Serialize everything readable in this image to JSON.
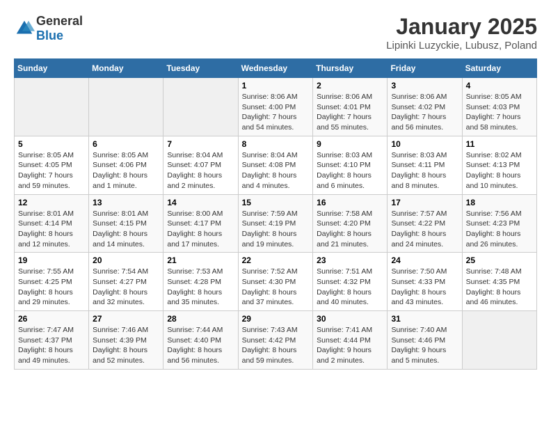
{
  "header": {
    "logo_general": "General",
    "logo_blue": "Blue",
    "title": "January 2025",
    "subtitle": "Lipinki Luzyckie, Lubusz, Poland"
  },
  "days_of_week": [
    "Sunday",
    "Monday",
    "Tuesday",
    "Wednesday",
    "Thursday",
    "Friday",
    "Saturday"
  ],
  "weeks": [
    [
      {
        "day": "",
        "info": ""
      },
      {
        "day": "",
        "info": ""
      },
      {
        "day": "",
        "info": ""
      },
      {
        "day": "1",
        "info": "Sunrise: 8:06 AM\nSunset: 4:00 PM\nDaylight: 7 hours and 54 minutes."
      },
      {
        "day": "2",
        "info": "Sunrise: 8:06 AM\nSunset: 4:01 PM\nDaylight: 7 hours and 55 minutes."
      },
      {
        "day": "3",
        "info": "Sunrise: 8:06 AM\nSunset: 4:02 PM\nDaylight: 7 hours and 56 minutes."
      },
      {
        "day": "4",
        "info": "Sunrise: 8:05 AM\nSunset: 4:03 PM\nDaylight: 7 hours and 58 minutes."
      }
    ],
    [
      {
        "day": "5",
        "info": "Sunrise: 8:05 AM\nSunset: 4:05 PM\nDaylight: 7 hours and 59 minutes."
      },
      {
        "day": "6",
        "info": "Sunrise: 8:05 AM\nSunset: 4:06 PM\nDaylight: 8 hours and 1 minute."
      },
      {
        "day": "7",
        "info": "Sunrise: 8:04 AM\nSunset: 4:07 PM\nDaylight: 8 hours and 2 minutes."
      },
      {
        "day": "8",
        "info": "Sunrise: 8:04 AM\nSunset: 4:08 PM\nDaylight: 8 hours and 4 minutes."
      },
      {
        "day": "9",
        "info": "Sunrise: 8:03 AM\nSunset: 4:10 PM\nDaylight: 8 hours and 6 minutes."
      },
      {
        "day": "10",
        "info": "Sunrise: 8:03 AM\nSunset: 4:11 PM\nDaylight: 8 hours and 8 minutes."
      },
      {
        "day": "11",
        "info": "Sunrise: 8:02 AM\nSunset: 4:13 PM\nDaylight: 8 hours and 10 minutes."
      }
    ],
    [
      {
        "day": "12",
        "info": "Sunrise: 8:01 AM\nSunset: 4:14 PM\nDaylight: 8 hours and 12 minutes."
      },
      {
        "day": "13",
        "info": "Sunrise: 8:01 AM\nSunset: 4:15 PM\nDaylight: 8 hours and 14 minutes."
      },
      {
        "day": "14",
        "info": "Sunrise: 8:00 AM\nSunset: 4:17 PM\nDaylight: 8 hours and 17 minutes."
      },
      {
        "day": "15",
        "info": "Sunrise: 7:59 AM\nSunset: 4:19 PM\nDaylight: 8 hours and 19 minutes."
      },
      {
        "day": "16",
        "info": "Sunrise: 7:58 AM\nSunset: 4:20 PM\nDaylight: 8 hours and 21 minutes."
      },
      {
        "day": "17",
        "info": "Sunrise: 7:57 AM\nSunset: 4:22 PM\nDaylight: 8 hours and 24 minutes."
      },
      {
        "day": "18",
        "info": "Sunrise: 7:56 AM\nSunset: 4:23 PM\nDaylight: 8 hours and 26 minutes."
      }
    ],
    [
      {
        "day": "19",
        "info": "Sunrise: 7:55 AM\nSunset: 4:25 PM\nDaylight: 8 hours and 29 minutes."
      },
      {
        "day": "20",
        "info": "Sunrise: 7:54 AM\nSunset: 4:27 PM\nDaylight: 8 hours and 32 minutes."
      },
      {
        "day": "21",
        "info": "Sunrise: 7:53 AM\nSunset: 4:28 PM\nDaylight: 8 hours and 35 minutes."
      },
      {
        "day": "22",
        "info": "Sunrise: 7:52 AM\nSunset: 4:30 PM\nDaylight: 8 hours and 37 minutes."
      },
      {
        "day": "23",
        "info": "Sunrise: 7:51 AM\nSunset: 4:32 PM\nDaylight: 8 hours and 40 minutes."
      },
      {
        "day": "24",
        "info": "Sunrise: 7:50 AM\nSunset: 4:33 PM\nDaylight: 8 hours and 43 minutes."
      },
      {
        "day": "25",
        "info": "Sunrise: 7:48 AM\nSunset: 4:35 PM\nDaylight: 8 hours and 46 minutes."
      }
    ],
    [
      {
        "day": "26",
        "info": "Sunrise: 7:47 AM\nSunset: 4:37 PM\nDaylight: 8 hours and 49 minutes."
      },
      {
        "day": "27",
        "info": "Sunrise: 7:46 AM\nSunset: 4:39 PM\nDaylight: 8 hours and 52 minutes."
      },
      {
        "day": "28",
        "info": "Sunrise: 7:44 AM\nSunset: 4:40 PM\nDaylight: 8 hours and 56 minutes."
      },
      {
        "day": "29",
        "info": "Sunrise: 7:43 AM\nSunset: 4:42 PM\nDaylight: 8 hours and 59 minutes."
      },
      {
        "day": "30",
        "info": "Sunrise: 7:41 AM\nSunset: 4:44 PM\nDaylight: 9 hours and 2 minutes."
      },
      {
        "day": "31",
        "info": "Sunrise: 7:40 AM\nSunset: 4:46 PM\nDaylight: 9 hours and 5 minutes."
      },
      {
        "day": "",
        "info": ""
      }
    ]
  ]
}
